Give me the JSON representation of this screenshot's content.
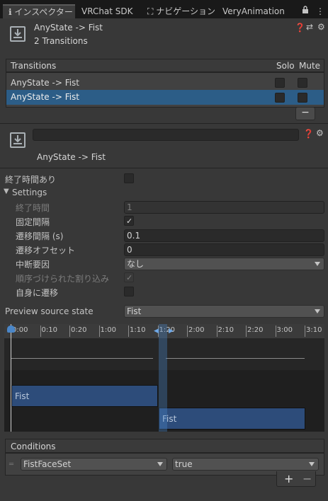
{
  "tabs": [
    {
      "label": "インスペクター",
      "icon": "info-icon"
    },
    {
      "label": "VRChat SDK"
    },
    {
      "label": "ナビゲーション",
      "icon": "navigation-icon"
    },
    {
      "label": "VeryAnimation"
    }
  ],
  "header": {
    "title": "AnyState -> Fist",
    "subtitle": "2 Transitions"
  },
  "transitions_list": {
    "header": "Transitions",
    "solo_label": "Solo",
    "mute_label": "Mute",
    "rows": [
      {
        "label": "AnyState -> Fist",
        "selected": false
      },
      {
        "label": "AnyState -> Fist",
        "selected": true
      }
    ],
    "remove_label": "−"
  },
  "transition": {
    "name_value": "",
    "title": "AnyState -> Fist"
  },
  "settings": {
    "has_exit_time_label": "終了時間あり",
    "settings_label": "Settings",
    "exit_time_label": "終了時間",
    "exit_time_value": "1",
    "fixed_duration_label": "固定間隔",
    "transition_duration_label": "遷移間隔 (s)",
    "transition_duration_value": "0.1",
    "transition_offset_label": "遷移オフセット",
    "transition_offset_value": "0",
    "interruption_source_label": "中断要因",
    "interruption_source_value": "なし",
    "ordered_interruption_label": "順序づけられた割り込み",
    "can_transition_to_self_label": "自身に遷移",
    "preview_source_label": "Preview source state",
    "preview_source_value": "Fist"
  },
  "timeline": {
    "ticks": [
      "0:00",
      "0:10",
      "0:20",
      "1:00",
      "1:10",
      "1:20",
      "2:00",
      "2:10",
      "2:20",
      "3:00",
      "3:10"
    ],
    "source_state": "Fist",
    "dest_state": "Fist"
  },
  "conditions": {
    "header": "Conditions",
    "param": "FistFaceSet",
    "value": "true",
    "add_label": "+",
    "remove_label": "−"
  },
  "colors": {
    "selected_row": "#2c5d87",
    "state_bar": "#2d4c7a",
    "accent_blue": "#4a86c8"
  }
}
